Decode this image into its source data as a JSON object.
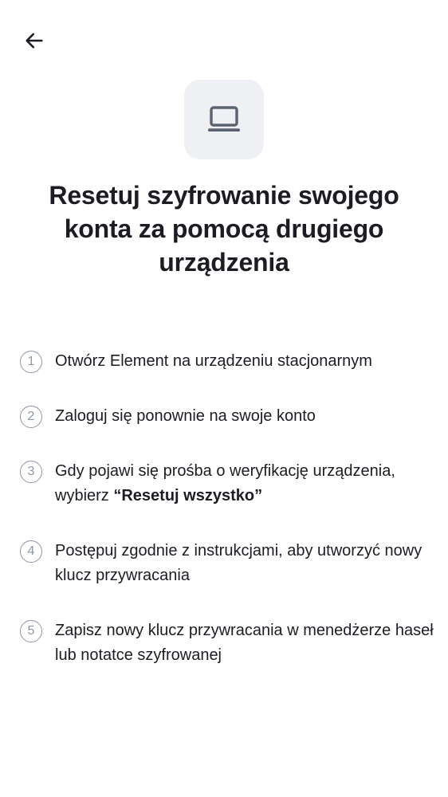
{
  "header": {
    "back_icon": "arrow-left-icon"
  },
  "hero": {
    "icon": "laptop-icon",
    "icon_bg": "#eef0f4",
    "icon_color": "#5b6270"
  },
  "title": "Resetuj szyfrowanie swojego konta za pomocą drugiego urządzenia",
  "steps": [
    {
      "number": "1",
      "text": "Otwórz Element na urządzeniu stacjonarnym"
    },
    {
      "number": "2",
      "text": "Zaloguj się ponownie na swoje konto"
    },
    {
      "number": "3",
      "text_before": "Gdy pojawi się prośba o weryfikację urządzenia, wybierz ",
      "text_bold": "“Resetuj wszystko”"
    },
    {
      "number": "4",
      "text": "Postępuj zgodnie z instrukcjami, aby utworzyć nowy klucz przywracania"
    },
    {
      "number": "5",
      "text": "Zapisz nowy klucz przywracania w menedżerze haseł lub notatce szyfrowanej"
    }
  ]
}
